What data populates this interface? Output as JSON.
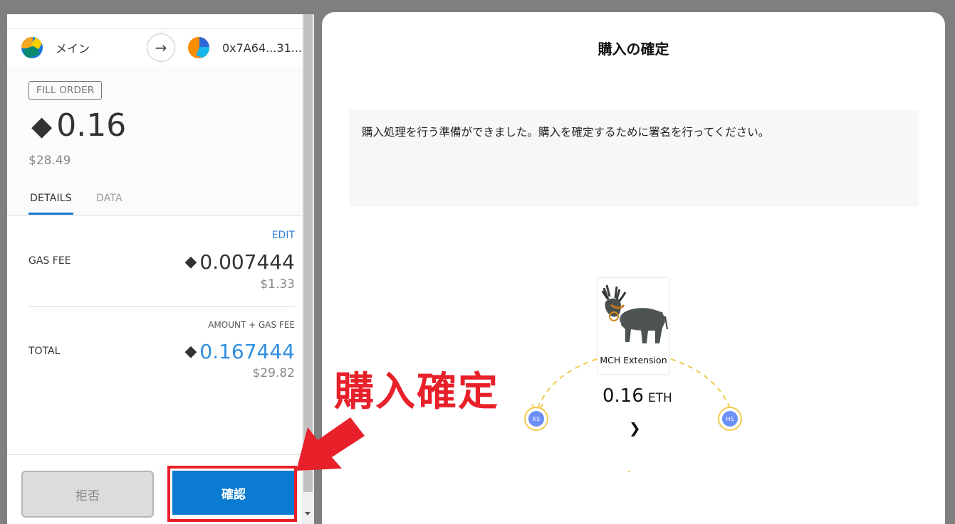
{
  "wallet": {
    "from_account": "メイン",
    "to_account": "0x7A64...31...",
    "badge": "FILL ORDER",
    "amount_eth": "0.16",
    "amount_usd": "$28.49",
    "tabs": [
      {
        "label": "DETAILS",
        "active": true
      },
      {
        "label": "DATA",
        "active": false
      }
    ],
    "edit_label": "EDIT",
    "gas_fee": {
      "label": "GAS FEE",
      "value": "0.007444",
      "usd": "$1.33"
    },
    "total": {
      "note": "AMOUNT + GAS FEE",
      "label": "TOTAL",
      "value": "0.167444",
      "usd": "$29.82"
    },
    "reject_label": "拒否",
    "confirm_label": "確認",
    "eth_glyph": "◆"
  },
  "annotation": {
    "text": "購入確定",
    "color": "#e8202a"
  },
  "modal": {
    "title": "購入の確定",
    "message": "購入処理を行う準備ができました。購入を確定するために署名を行ってください。",
    "hero_name": "MCH Extension",
    "price_value": "0.16",
    "price_unit": "ETH",
    "chevron": "❯",
    "left_node": "KS",
    "right_node": "HS"
  },
  "colors": {
    "accent_blue": "#0b7ad1",
    "link_blue": "#2f80cf",
    "total_blue": "#2f8fe0",
    "node_blue": "#6b8ef7",
    "arc_yellow": "#f2c94c"
  }
}
